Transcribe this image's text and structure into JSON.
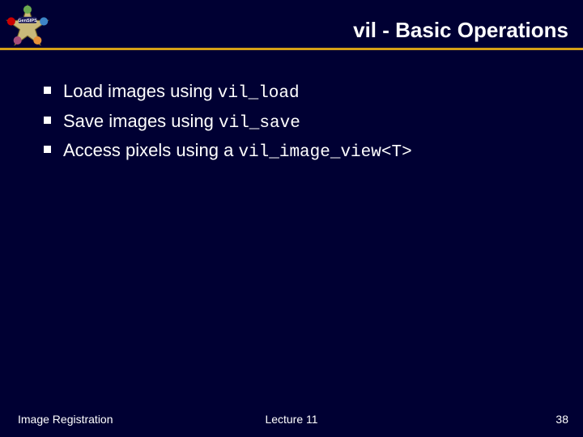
{
  "header": {
    "title": "vil - Basic Operations",
    "logo_label": "GenSIPS"
  },
  "bullets": [
    {
      "pre": "Load images using ",
      "code": "vil_load",
      "post": ""
    },
    {
      "pre": "Save images using ",
      "code": "vil_save",
      "post": ""
    },
    {
      "pre": "Access pixels using a ",
      "code": "vil_image_view<T>",
      "post": ""
    }
  ],
  "footer": {
    "left": "Image Registration",
    "center": "Lecture 11",
    "right": "38"
  }
}
